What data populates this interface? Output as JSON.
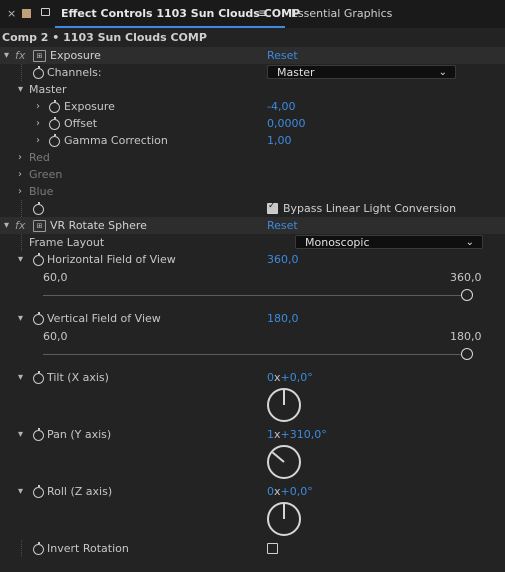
{
  "tabs": {
    "close_glyph": "×",
    "active_label": "Effect Controls 1103 Sun Clouds COMP",
    "menu_glyph": "≡",
    "other_label": "Essential Graphics"
  },
  "breadcrumb": "Comp 2 • 1103 Sun Clouds COMP",
  "exposure": {
    "fx_label": "fx",
    "name": "Exposure",
    "reset": "Reset",
    "channels_label": "Channels:",
    "channels_value": "Master",
    "master_label": "Master",
    "params": [
      {
        "label": "Exposure",
        "value": "-4,00"
      },
      {
        "label": "Offset",
        "value": "0,0000"
      },
      {
        "label": "Gamma Correction",
        "value": "1,00"
      }
    ],
    "channels": [
      "Red",
      "Green",
      "Blue"
    ],
    "bypass_label": "Bypass Linear Light Conversion",
    "bypass_checked": true
  },
  "vr": {
    "fx_label": "fx",
    "name": "VR Rotate Sphere",
    "reset": "Reset",
    "frame_layout_label": "Frame Layout",
    "frame_layout_value": "Monoscopic",
    "hfov": {
      "label": "Horizontal Field of View",
      "value": "360,0",
      "min": "60,0",
      "max": "360,0",
      "fraction": 1.0
    },
    "vfov": {
      "label": "Vertical Field of View",
      "value": "180,0",
      "min": "60,0",
      "max": "180,0",
      "fraction": 1.0
    },
    "tilt": {
      "label": "Tilt (X axis)",
      "revs": "0",
      "x": "x",
      "deg": "+0,0°",
      "angle": 0
    },
    "pan": {
      "label": "Pan (Y axis)",
      "revs": "1",
      "x": "x",
      "deg": "+310,0°",
      "angle": 310
    },
    "roll": {
      "label": "Roll (Z axis)",
      "revs": "0",
      "x": "x",
      "deg": "+0,0°",
      "angle": 0
    },
    "invert_label": "Invert Rotation",
    "invert_checked": false
  },
  "colors": {
    "accent": "#3d8ae0",
    "background": "#232323"
  }
}
